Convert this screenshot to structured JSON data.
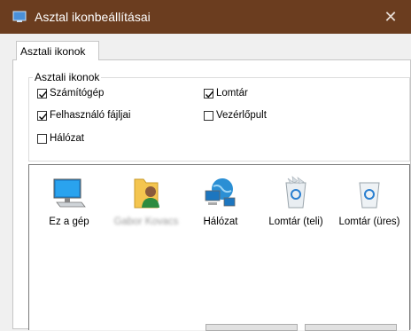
{
  "window": {
    "title": "Asztal ikonbeállításai",
    "close_glyph": "✕",
    "titlebar_color": "#6b3d1f"
  },
  "tabs": [
    {
      "label": "Asztali ikonok",
      "active": true
    }
  ],
  "group": {
    "legend": "Asztali ikonok",
    "checkboxes": [
      {
        "label": "Számítógép",
        "checked": true
      },
      {
        "label": "Lomtár",
        "checked": true
      },
      {
        "label": "Felhasználó fájljai",
        "checked": true
      },
      {
        "label": "Vezérlőpult",
        "checked": false
      },
      {
        "label": "Hálózat",
        "checked": false
      }
    ]
  },
  "icons": [
    {
      "name": "computer-icon",
      "label": "Ez a gép"
    },
    {
      "name": "user-folder-icon",
      "label": "Gabor Kovacs",
      "blurred": true
    },
    {
      "name": "network-icon",
      "label": "Hálózat"
    },
    {
      "name": "recycle-bin-full-icon",
      "label": "Lomtár (teli)"
    },
    {
      "name": "recycle-bin-empty-icon",
      "label": "Lomtár (üres)"
    }
  ]
}
